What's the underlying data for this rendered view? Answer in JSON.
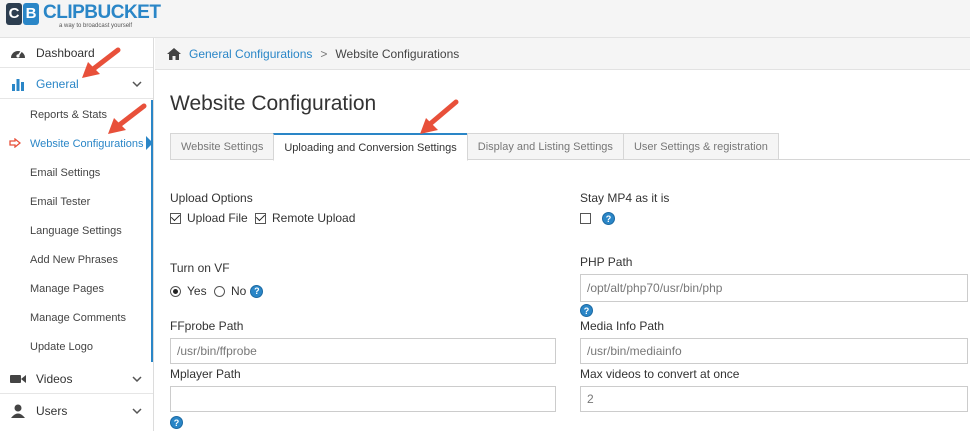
{
  "brand": {
    "logo_letters": [
      "C",
      "B"
    ],
    "name": "CLIPBUCKET",
    "tagline": "a way to broadcast yourself"
  },
  "sidebar": {
    "dashboard": "Dashboard",
    "general": "General",
    "general_items": [
      "Reports & Stats",
      "Website Configurations",
      "Email Settings",
      "Email Tester",
      "Language Settings",
      "Add New Phrases",
      "Manage Pages",
      "Manage Comments",
      "Update Logo"
    ],
    "videos": "Videos",
    "users": "Users"
  },
  "breadcrumb": {
    "parent": "General Configurations",
    "separator": ">",
    "current": "Website Configurations"
  },
  "page": {
    "title": "Website Configuration"
  },
  "tabs": [
    {
      "label": "Website Settings",
      "active": false
    },
    {
      "label": "Uploading and Conversion Settings",
      "active": true
    },
    {
      "label": "Display and Listing Settings",
      "active": false
    },
    {
      "label": "User Settings & registration",
      "active": false
    }
  ],
  "form": {
    "upload_options": {
      "label": "Upload Options",
      "upload_file": "Upload File",
      "remote_upload": "Remote Upload"
    },
    "stay_mp4": {
      "label": "Stay MP4 as it is"
    },
    "turn_on_vf": {
      "label": "Turn on VF",
      "yes": "Yes",
      "no": "No",
      "selected": "Yes"
    },
    "php_path": {
      "label": "PHP Path",
      "value": "/opt/alt/php70/usr/bin/php"
    },
    "ffprobe_path": {
      "label": "FFprobe Path",
      "value": "/usr/bin/ffprobe"
    },
    "media_info_path": {
      "label": "Media Info Path",
      "value": "/usr/bin/mediainfo"
    },
    "mplayer_path": {
      "label": "Mplayer Path",
      "value": ""
    },
    "max_videos": {
      "label": "Max videos to convert at once",
      "value": "2"
    },
    "help_glyph": "?"
  },
  "colors": {
    "accent": "#2a86c7",
    "arrow": "#e8503a",
    "topbar": "#f5f5f5"
  }
}
